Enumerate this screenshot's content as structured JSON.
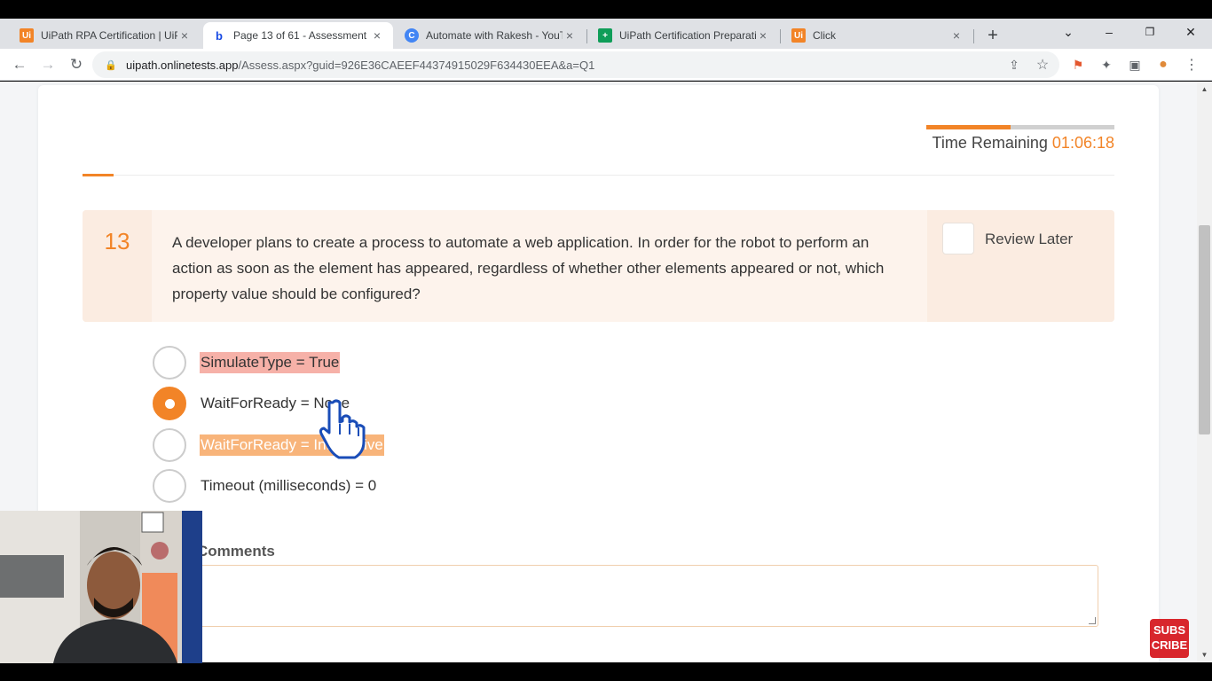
{
  "browser": {
    "tabs": [
      {
        "favicon": "Ui",
        "title": "UiPath RPA Certification | UiP",
        "close": "×"
      },
      {
        "favicon": "b",
        "title": "Page 13 of 61 - Assessment ·",
        "close": "×"
      },
      {
        "favicon": "C",
        "title": "Automate with Rakesh - YouT",
        "close": "×"
      },
      {
        "favicon": "+",
        "title": "UiPath Certification Preparati",
        "close": "×"
      },
      {
        "favicon": "Ui",
        "title": "Click",
        "close": "×"
      }
    ],
    "new_tab": "+",
    "window_controls": {
      "tab_search": "⌄",
      "minimize": "–",
      "restore": "❐",
      "close": "✕"
    },
    "nav": {
      "back": "←",
      "forward": "→",
      "reload": "↻"
    },
    "url": {
      "lock": "🔒",
      "host": "uipath.onlinetests.app",
      "path": "/Assess.aspx?guid=926E36CAEEF44374915029F634430EEA&a=Q1"
    },
    "omni_icons": {
      "share": "⇪",
      "bookmark": "☆"
    },
    "ext_icons": {
      "ext1": "⚑",
      "puzzle": "✦",
      "sidebar": "▣",
      "profile": "●",
      "menu": "⋮"
    },
    "accent": "#f28427"
  },
  "assessment": {
    "timer_label": "Time Remaining",
    "timer_value": "01:06:18",
    "progress_fraction": 0.45,
    "question_number": "13",
    "question_text": "A developer plans to create a process to automate a web application. In order for the robot to perform an action as soon as the element has appeared, regardless of whether other elements appeared or not, which property value should be configured?",
    "review_label": "Review Later",
    "options": [
      {
        "label": "SimulateType = True",
        "highlight": "red",
        "selected": false
      },
      {
        "label": "WaitForReady = None",
        "highlight": "none",
        "selected": true
      },
      {
        "label": "WaitForReady = Interactive",
        "highlight": "orange",
        "selected": false
      },
      {
        "label": "Timeout (milliseconds) = 0",
        "highlight": "none",
        "selected": false
      }
    ],
    "comments_label": "Comments"
  },
  "overlay": {
    "subscribe": [
      "SUBS",
      "CRIBE"
    ]
  }
}
